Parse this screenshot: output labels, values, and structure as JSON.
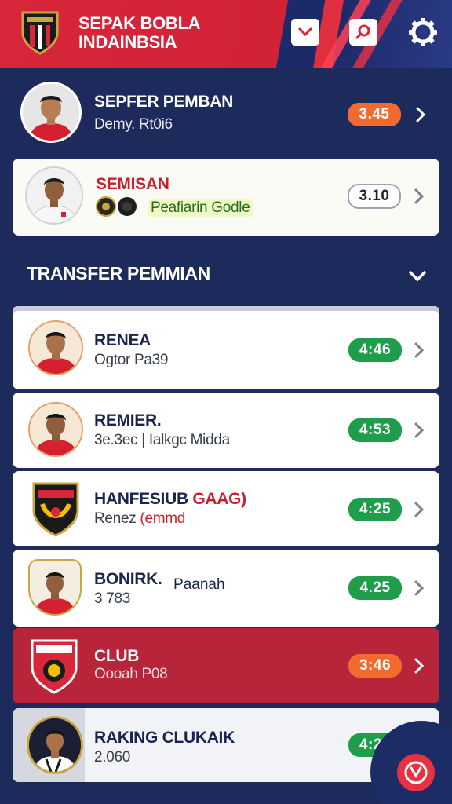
{
  "app": {
    "title_line1": "SEPAK BOBLA",
    "title_line2": "INDAINBSIA",
    "logo_icon": "club-shield-icon",
    "header_buttons": [
      "dropdown-icon",
      "search-icon",
      "gear-icon"
    ]
  },
  "featured": [
    {
      "name": "SEPFER PEMBAN",
      "sub": "Demy. Rt0i6",
      "score": "3.45",
      "score_color": "#f26a2e"
    },
    {
      "name": "SEMISAN",
      "sub": "Peafiarin Godle",
      "score": "3.10",
      "score_color": "#ffffff"
    }
  ],
  "section": {
    "title": "TRANSFER PEMMIAN"
  },
  "list": [
    {
      "name": "RENEA",
      "sub": "Ogtor Pa39",
      "score": "4:46",
      "score_color": "#1e9e4a"
    },
    {
      "name": "REMIER.",
      "sub": "3e.3ec | Ialkgc Midda",
      "score": "4:53",
      "score_color": "#1e9e4a"
    },
    {
      "name": "HANFESIUB",
      "name_accent": "GAAG)",
      "sub": "Renez",
      "sub_accent": "(emmd",
      "score": "4:25",
      "score_color": "#1e9e4a"
    },
    {
      "name": "BONIRK.",
      "name_extra": "Paanah",
      "sub": "3 783",
      "score": "4.25",
      "score_color": "#1e9e4a"
    },
    {
      "name": "CLUB",
      "sub": "Oooah P08",
      "score": "3:46",
      "score_color": "#f26a2e"
    },
    {
      "name": "RAKING CLUKAIK",
      "sub": "2.060",
      "score": "4:25",
      "score_color": "#1e9e4a"
    }
  ]
}
